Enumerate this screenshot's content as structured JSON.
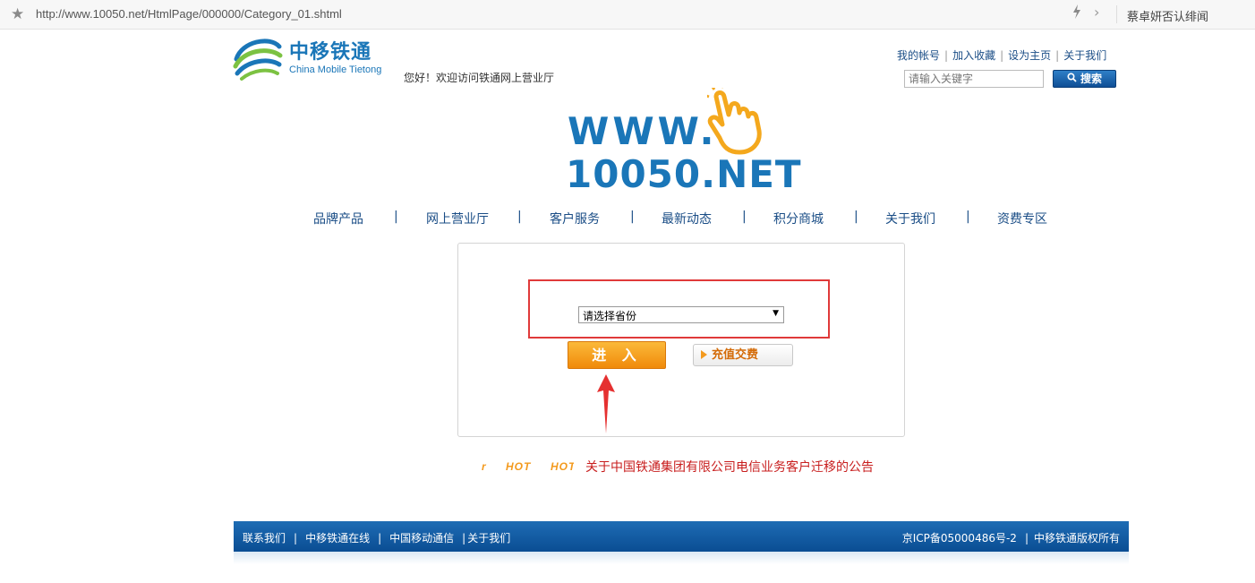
{
  "browser": {
    "url": "http://www.10050.net/HtmlPage/000000/Category_01.shtml",
    "right_text": "蔡卓妍否认绯闻"
  },
  "header": {
    "logo_cn": "中移铁通",
    "logo_en": "China Mobile Tietong",
    "welcome": "您好！欢迎访问铁通网上营业厅",
    "links": [
      "我的帐号",
      "加入收藏",
      "设为主页",
      "关于我们"
    ],
    "search_placeholder": "请输入关键字",
    "search_button": "搜索"
  },
  "banner": {
    "line1": "WWW.",
    "line2": "10050.NET"
  },
  "nav": {
    "items": [
      "品牌产品",
      "网上营业厅",
      "客户服务",
      "最新动态",
      "积分商城",
      "关于我们",
      "资费专区"
    ]
  },
  "main": {
    "province_select": "请选择省份",
    "enter_button": "进 入",
    "recharge_button": "充值交费"
  },
  "news": {
    "hot_labels": [
      "r",
      "HOT",
      "HOT"
    ],
    "headline": "关于中国铁通集团有限公司电信业务客户迁移的公告"
  },
  "footer": {
    "left_links": [
      "联系我们",
      "中移铁通在线",
      "中国移动通信",
      "关于我们"
    ],
    "icp": "京ICP备05000486号-2",
    "copyright": "中移铁通版权所有"
  },
  "colors": {
    "brand_blue": "#1a76b8",
    "accent_orange": "#f39a1e",
    "highlight_red": "#e03a3a"
  }
}
